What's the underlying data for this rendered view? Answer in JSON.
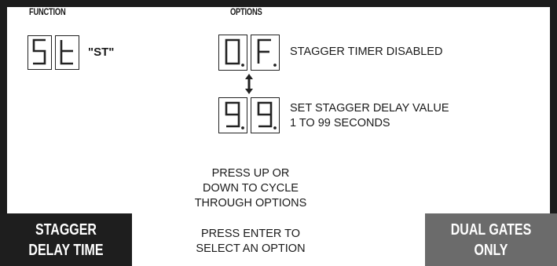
{
  "function_header": "FUNCTION",
  "options_header": "OPTIONS",
  "function_code": "\"ST\"",
  "function_display": [
    "5",
    "t"
  ],
  "option_off_display": [
    "0.",
    "F."
  ],
  "option_off_label": "STAGGER TIMER DISABLED",
  "option_range_display": [
    "9.",
    "9."
  ],
  "option_range_label_line1": "SET STAGGER DELAY VALUE",
  "option_range_label_line2": "1 TO 99 SECONDS",
  "cycle_instruction": [
    "PRESS UP OR",
    "DOWN TO CYCLE",
    "THROUGH OPTIONS"
  ],
  "select_instruction": [
    "PRESS ENTER TO",
    "SELECT AN OPTION"
  ],
  "left_box": [
    "STAGGER",
    "DELAY TIME"
  ],
  "right_box": [
    "DUAL GATES",
    "ONLY"
  ],
  "colors": {
    "frame": "#1c1c1c",
    "left_box": "#1e1e1e",
    "right_box": "#6b6b6b",
    "text": "#1a1a1a"
  },
  "icons": {
    "cycle_arrow": "up-down-arrow-icon"
  }
}
